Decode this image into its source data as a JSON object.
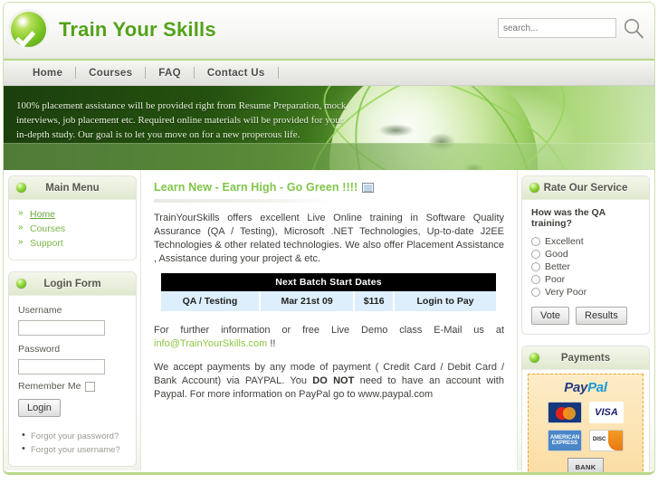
{
  "header": {
    "site_title": "Train Your Skills",
    "logo_icon": "green-check-circle-icon",
    "search_placeholder": "search...",
    "search_value": "",
    "search_icon": "magnifier-icon"
  },
  "nav": {
    "items": [
      {
        "label": "Home"
      },
      {
        "label": "Courses"
      },
      {
        "label": "FAQ"
      },
      {
        "label": "Contact Us"
      }
    ]
  },
  "banner": {
    "text": "100% placement assistance will be provided right from Resume Preparation, mock interviews, job placement etc. Required online materials will be provided for your in-depth study. Our goal is to let you move on for a new properous life.",
    "image": "green-globe-with-orbit-rings"
  },
  "sidebar_left": {
    "main_menu": {
      "title": "Main Menu",
      "bullet_icon": "green-glossy-dot-icon",
      "items": [
        {
          "label": "Home",
          "active": true
        },
        {
          "label": "Courses",
          "active": false
        },
        {
          "label": "Support",
          "active": false
        }
      ]
    },
    "login_form": {
      "title": "Login Form",
      "bullet_icon": "green-glossy-dot-icon",
      "username_label": "Username",
      "username_value": "",
      "password_label": "Password",
      "password_value": "",
      "remember_label": "Remember Me",
      "login_button": "Login",
      "links": [
        {
          "label": "Forgot your password?"
        },
        {
          "label": "Forgot your username?"
        }
      ]
    }
  },
  "main": {
    "article_title": "Learn New - Earn High - Go Green !!!!",
    "article_icon": "print-article-icon",
    "paragraph_1": "TrainYourSkills offers excellent Live Online training in Software Quality Assurance (QA / Testing), Microsoft .NET Technologies, Up-to-date J2EE Technologies & other related technologies. We also offer Placement Assistance , Assistance during your project & etc.",
    "batch_table": {
      "header": "Next Batch Start Dates",
      "rows": [
        {
          "course": "QA / Testing",
          "date": "Mar 21st 09",
          "price": "$116",
          "action": "Login to Pay"
        }
      ]
    },
    "contact_prefix": "For further information or free Live Demo class E-Mail us at ",
    "contact_email": "info@TrainYourSkills.com",
    "contact_suffix": " !!",
    "payment_part_1": "We accept payments by any mode of payment ( Credit Card / Debit Card / Bank Account) via PAYPAL. You ",
    "payment_emphasis": "DO NOT",
    "payment_part_2": " need to have an account with Paypal. For more information on PayPal go to www.paypal.com"
  },
  "sidebar_right": {
    "poll": {
      "title": "Rate Our Service",
      "bullet_icon": "green-glossy-dot-icon",
      "question": "How was the QA training?",
      "options": [
        {
          "label": "Excellent"
        },
        {
          "label": "Good"
        },
        {
          "label": "Better"
        },
        {
          "label": "Poor"
        },
        {
          "label": "Very Poor"
        }
      ],
      "vote_button": "Vote",
      "results_button": "Results"
    },
    "payments": {
      "title": "Payments",
      "bullet_icon": "green-glossy-dot-icon",
      "brand_part_1": "Pay",
      "brand_part_2": "Pal",
      "cards": [
        {
          "name": "mastercard-logo",
          "label": "MasterCard"
        },
        {
          "name": "visa-logo",
          "label": "VISA"
        },
        {
          "name": "amex-logo",
          "label": "AMERICAN EXPRESS"
        },
        {
          "name": "discover-logo",
          "label": "DISCOVER"
        },
        {
          "name": "bank-logo",
          "label": "BANK"
        }
      ]
    }
  },
  "colors": {
    "brand_green": "#53a219",
    "accent_green": "#8cc63f",
    "title_green": "#80c64a",
    "price_red": "#dd1100",
    "table_row_blue": "#ddeefc",
    "banner_dark": "#1f4410"
  }
}
